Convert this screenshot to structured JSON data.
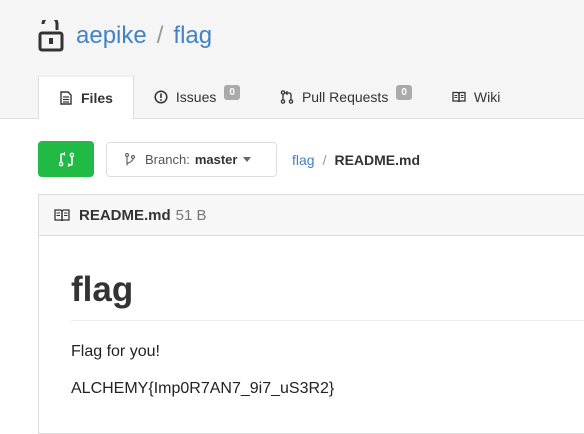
{
  "repo": {
    "owner": "aepike",
    "separator": "/",
    "name": "flag"
  },
  "tabs": [
    {
      "label": "Files",
      "icon": "file-text-icon",
      "active": true
    },
    {
      "label": "Issues",
      "icon": "issue-opened-icon",
      "count": "0"
    },
    {
      "label": "Pull Requests",
      "icon": "git-pull-request-icon",
      "count": "0"
    },
    {
      "label": "Wiki",
      "icon": "book-icon"
    }
  ],
  "toolbar": {
    "compare_icon": "git-compare-icon",
    "branch_label": "Branch:",
    "branch_value": "master",
    "breadcrumb_repo": "flag",
    "breadcrumb_sep": "/",
    "breadcrumb_file": "README.md"
  },
  "file": {
    "name": "README.md",
    "size": "51 B",
    "icon": "book-icon"
  },
  "readme": {
    "heading": "flag",
    "p1": "Flag for you!",
    "p2": "ALCHEMY{Imp0R7AN7_9i7_uS3R2}"
  },
  "colors": {
    "link": "#4183c4",
    "compare_button": "#21ba45",
    "badge": "#aaaaaa"
  }
}
